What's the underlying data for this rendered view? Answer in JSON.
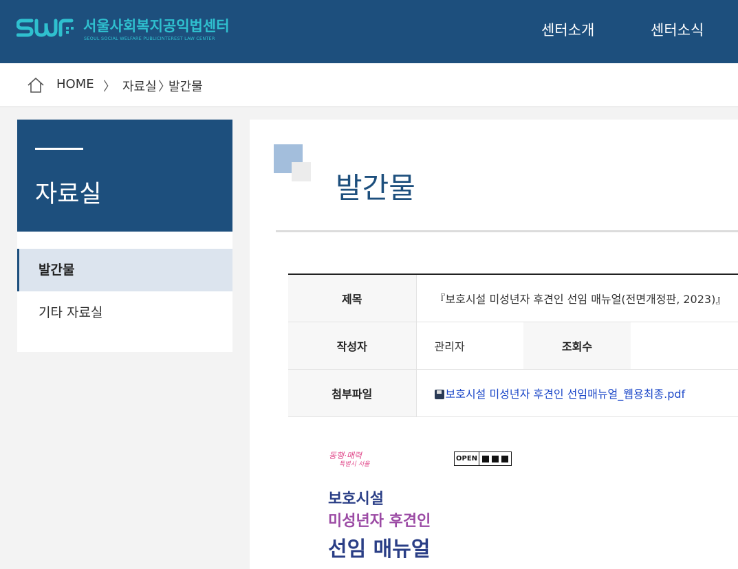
{
  "header": {
    "logo_mark": "SWF",
    "logo_title": "서울사회복지공익법센터",
    "logo_subtitle": "SEOUL SOCIAL WELFARE PUBLICINTEREST LAW CENTER",
    "nav": [
      {
        "label": "센터소개"
      },
      {
        "label": "센터소식"
      }
    ]
  },
  "breadcrumb": {
    "home": "HOME",
    "sep1": "〉",
    "level1": "자료실",
    "sep2": "〉",
    "level2": "발간물"
  },
  "sidebar": {
    "title": "자료실",
    "items": [
      {
        "label": "발간물",
        "active": true
      },
      {
        "label": "기타 자료실",
        "active": false
      }
    ]
  },
  "content": {
    "page_title": "발간물",
    "table": {
      "title_label": "제목",
      "title_value": "『보호시설 미성년자 후견인 선임 매뉴얼(전면개정판, 2023)』",
      "author_label": "작성자",
      "author_value": "관리자",
      "views_label": "조회수",
      "file_label": "첨부파일",
      "file_value": "보호시설 미성년자 후견인 선임매뉴얼_웹용최종.pdf"
    },
    "poster": {
      "brand": "동행·매력",
      "brand_sub": "특별시 서울",
      "open_badge": "OPEN",
      "line1": "보호시설",
      "line2": "미성년자 후견인",
      "line3": "선임 매뉴얼"
    }
  },
  "colors": {
    "brand_navy": "#1d4f7d",
    "logo_teal": "#2fc0cf",
    "link_blue": "#1a46c8"
  }
}
